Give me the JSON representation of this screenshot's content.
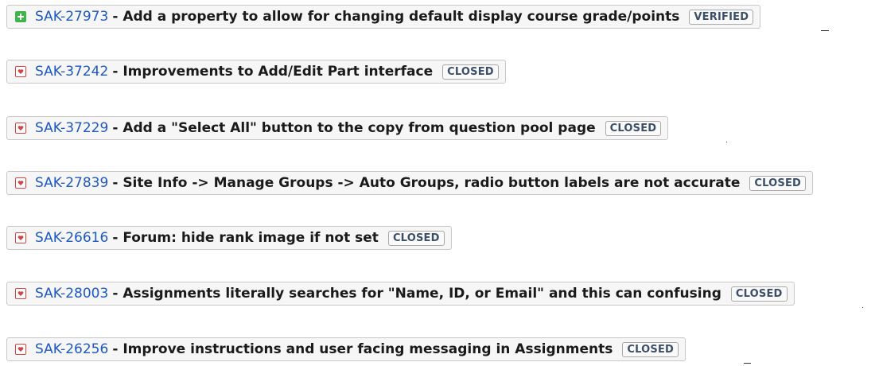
{
  "issues": [
    {
      "type_icon": "plus-icon",
      "type": "new-feature",
      "key": "SAK-27973",
      "separator": "-",
      "summary": "Add a property to allow for changing default display course grade/points",
      "status": "VERIFIED"
    },
    {
      "type_icon": "improvement-icon",
      "type": "improvement",
      "key": "SAK-37242",
      "separator": "-",
      "summary": "Improvements to Add/Edit Part interface",
      "status": "CLOSED"
    },
    {
      "type_icon": "improvement-icon",
      "type": "improvement",
      "key": "SAK-37229",
      "separator": "-",
      "summary": "Add a \"Select All\" button to the copy from question pool page",
      "status": "CLOSED"
    },
    {
      "type_icon": "improvement-icon",
      "type": "improvement",
      "key": "SAK-27839",
      "separator": "-",
      "summary": "Site Info -> Manage Groups -> Auto Groups, radio button labels are not accurate",
      "status": "CLOSED"
    },
    {
      "type_icon": "improvement-icon",
      "type": "improvement",
      "key": "SAK-26616",
      "separator": "-",
      "summary": "Forum: hide rank image if not set",
      "status": "CLOSED"
    },
    {
      "type_icon": "improvement-icon",
      "type": "improvement",
      "key": "SAK-28003",
      "separator": "-",
      "summary": "Assignments literally searches for \"Name, ID, or Email\" and this can confusing",
      "status": "CLOSED"
    },
    {
      "type_icon": "improvement-icon",
      "type": "improvement",
      "key": "SAK-26256",
      "separator": "-",
      "summary": "Improve instructions and user facing messaging in Assignments",
      "status": "CLOSED"
    }
  ],
  "colors": {
    "link": "#1f58c7",
    "new_feature_icon": "#3db549",
    "improvement_icon": "#d24545",
    "row_border": "#c8c8c8",
    "row_background": "#f6f6f6"
  }
}
